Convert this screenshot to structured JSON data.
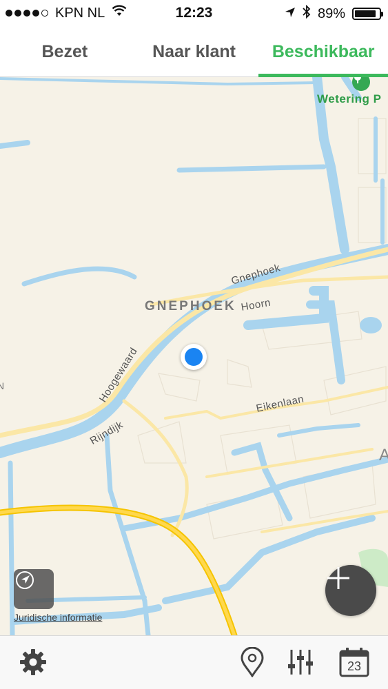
{
  "status_bar": {
    "carrier": "KPN NL",
    "time": "12:23",
    "battery": "89%",
    "battery_level": 0.89
  },
  "tabs": [
    {
      "label": "Bezet",
      "active": false
    },
    {
      "label": "Naar klant",
      "active": false
    },
    {
      "label": "Beschikbaar",
      "active": true
    }
  ],
  "map": {
    "labels": {
      "district": "GNEPHOEK",
      "street_gnephoek": "Gnephoek",
      "street_hoorn": "Hoorn",
      "street_hoogewaard": "Hoogewaard",
      "street_rijndijk": "Rijndijk",
      "street_eikenlaan": "Eikenlaan",
      "poi_wetering": "Wetering P",
      "edge_a": "A",
      "edge_n": "N"
    },
    "legal_link": "Juridische informatie",
    "colors": {
      "land": "#f6f2e7",
      "water": "#a9d4ee",
      "road": "#fbe7a6",
      "highway": "#f5c400",
      "accent": "#3cb95c"
    }
  },
  "toolbar": {
    "calendar_day": "23",
    "icons": [
      "gear-icon",
      "map-pin-icon",
      "sliders-icon",
      "calendar-icon"
    ]
  }
}
